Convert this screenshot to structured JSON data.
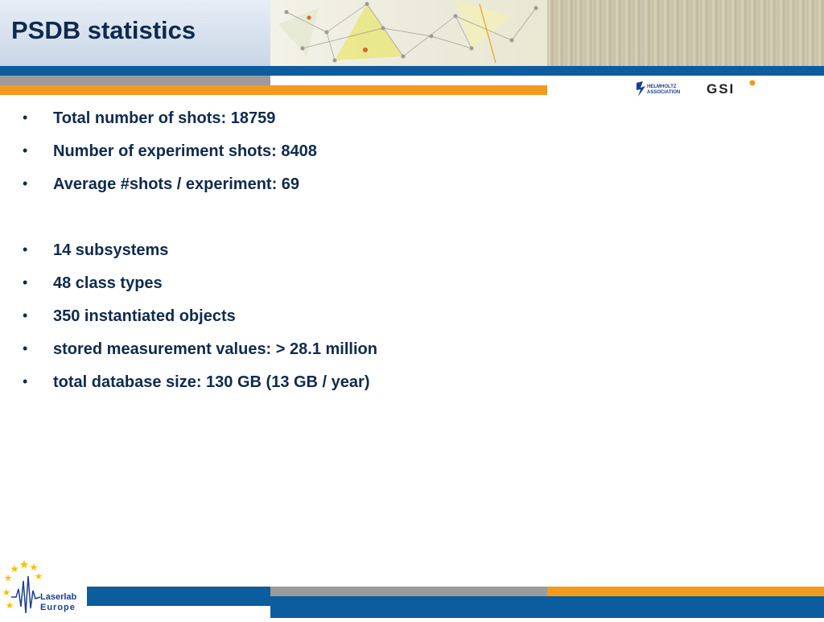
{
  "header": {
    "title": "PSDB statistics"
  },
  "logos": {
    "helmholtz": "HELMHOLTZ ASSOCIATION",
    "gsi": "GSI",
    "laserlab_line1": "Laserlab",
    "laserlab_line2": "Europe"
  },
  "bullets": [
    {
      "text": "Total number of shots: 18759"
    },
    {
      "text": "Number of experiment shots: 8408"
    },
    {
      "text": "Average #shots / experiment: 69"
    },
    {
      "text": "14 subsystems"
    },
    {
      "text": "48 class types"
    },
    {
      "text": "350 instantiated objects"
    },
    {
      "text": "stored  measurement values: > 28.1 million"
    },
    {
      "text": "total database size: 130 GB (13 GB / year)"
    }
  ],
  "bullet_symbol": "•",
  "colors": {
    "title": "#0f2a4d",
    "blue_bar": "#0b5d9e",
    "grey_bar": "#9b9b9b",
    "orange_bar": "#f39a1e"
  }
}
